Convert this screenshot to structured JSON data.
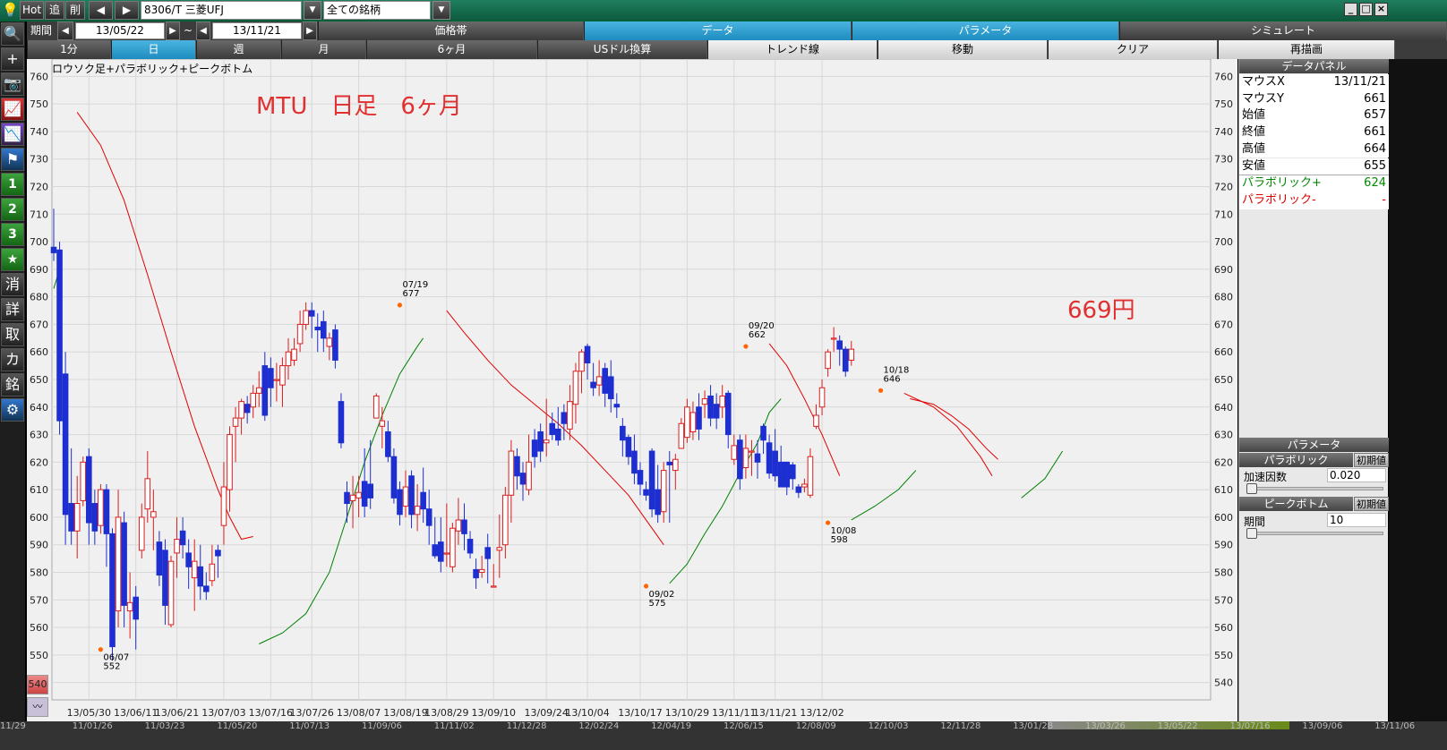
{
  "toolbar": {
    "hot_label": "Hot",
    "add_label": "追",
    "delete_label": "削",
    "symbol_value": "8306/T 三菱UFJ",
    "filter_value": "全ての銘柄",
    "period_label": "期間",
    "date_from": "13/05/22",
    "date_sep": "~",
    "date_to": "13/11/21"
  },
  "tabs_row2": [
    "価格帯",
    "データ",
    "パラメータ",
    "シミュレート"
  ],
  "tabs_row3": [
    "1分",
    "日",
    "週",
    "月",
    "6ヶ月",
    "USドル換算",
    "トレンド線",
    "移動",
    "クリア",
    "再描画"
  ],
  "sidebar": {
    "buttons": [
      "search-icon",
      "crosshair-icon",
      "camera-icon",
      "chart-icon",
      "compare-icon",
      "flag-icon",
      "1",
      "2",
      "3",
      "★",
      "消",
      "詳",
      "取",
      "カ",
      "銘",
      "gear-icon"
    ],
    "labels": [
      "🔍",
      "+",
      "📷",
      "📈",
      "📉",
      "⚑",
      "1",
      "2",
      "3",
      "★",
      "消",
      "詳",
      "取",
      "カ",
      "銘",
      "⚙"
    ]
  },
  "chart": {
    "indicator_label": "ロウソク足+パラボリック+ピークボトム",
    "annotation_title": "MTU　日足　6ヶ月",
    "annotation_price": "669円",
    "mini_label": "540"
  },
  "chart_data": {
    "type": "candlestick",
    "ylim": [
      535,
      765
    ],
    "y_ticks": [
      760,
      750,
      740,
      730,
      720,
      710,
      700,
      690,
      680,
      670,
      660,
      650,
      640,
      630,
      620,
      610,
      600,
      590,
      580,
      570,
      560,
      550,
      540
    ],
    "x_tick_labels": [
      "13/05/30",
      "13/06/11",
      "13/06/21",
      "13/07/03",
      "13/07/16",
      "13/07/26",
      "13/08/07",
      "13/08/19",
      "13/08/29",
      "13/09/10",
      "13/09/24",
      "13/10/04",
      "13/10/17",
      "13/10/29",
      "13/11/11",
      "13/11/21",
      "13/12/02"
    ],
    "x_tick_index": [
      6,
      14,
      21,
      29,
      37,
      44,
      52,
      60,
      67,
      75,
      84,
      91,
      100,
      108,
      116,
      123,
      131
    ],
    "candles": [
      [
        698,
        696,
        712,
        693
      ],
      [
        697,
        635,
        700,
        630
      ],
      [
        652,
        601,
        660,
        590
      ],
      [
        605,
        595,
        625,
        590
      ],
      [
        595,
        605,
        615,
        585
      ],
      [
        606,
        620,
        622,
        604
      ],
      [
        622,
        598,
        625,
        590
      ],
      [
        605,
        595,
        610,
        590
      ],
      [
        597,
        610,
        612,
        594
      ],
      [
        610,
        594,
        612,
        582
      ],
      [
        594,
        553,
        596,
        548
      ],
      [
        566,
        600,
        610,
        560
      ],
      [
        598,
        568,
        602,
        560
      ],
      [
        566,
        569,
        580,
        556
      ],
      [
        571,
        563,
        575,
        552
      ],
      [
        588,
        600,
        605,
        585
      ],
      [
        603,
        614,
        624,
        598
      ],
      [
        600,
        602,
        610,
        588
      ],
      [
        591,
        579,
        595,
        575
      ],
      [
        588,
        568,
        592,
        561
      ],
      [
        561,
        584,
        586,
        560
      ],
      [
        587,
        592,
        600,
        578
      ],
      [
        595,
        590,
        600,
        585
      ],
      [
        587,
        582,
        592,
        574
      ],
      [
        578,
        584,
        592,
        566
      ],
      [
        582,
        575,
        590,
        570
      ],
      [
        575,
        573,
        580,
        570
      ],
      [
        577,
        583,
        590,
        575
      ],
      [
        588,
        586,
        590,
        578
      ],
      [
        597,
        611,
        620,
        590
      ],
      [
        610,
        630,
        633,
        602
      ],
      [
        633,
        636,
        640,
        620
      ],
      [
        636,
        642,
        643,
        630
      ],
      [
        641,
        638,
        644,
        634
      ],
      [
        640,
        645,
        648,
        636
      ],
      [
        645,
        647,
        653,
        640
      ],
      [
        655,
        637,
        660,
        635
      ],
      [
        654,
        647,
        658,
        640
      ],
      [
        650,
        650,
        656,
        642
      ],
      [
        648,
        655,
        658,
        640
      ],
      [
        655,
        660,
        665,
        650
      ],
      [
        657,
        661,
        665,
        655
      ],
      [
        663,
        670,
        675,
        660
      ],
      [
        670,
        675,
        678,
        668
      ],
      [
        675,
        673,
        678,
        665
      ],
      [
        669,
        668,
        674,
        660
      ],
      [
        671,
        665,
        675,
        660
      ],
      [
        662,
        665,
        667,
        657
      ],
      [
        668,
        657,
        670,
        654
      ],
      [
        642,
        627,
        645,
        625
      ],
      [
        609,
        605,
        613,
        598
      ],
      [
        606,
        608,
        615,
        596
      ],
      [
        607,
        609,
        615,
        600
      ],
      [
        613,
        604,
        625,
        600
      ],
      [
        612,
        607,
        628,
        603
      ],
      [
        636,
        644,
        645,
        636
      ],
      [
        633,
        635,
        640,
        625
      ],
      [
        631,
        622,
        635,
        620
      ],
      [
        622,
        607,
        625,
        605
      ],
      [
        610,
        601,
        613,
        597
      ],
      [
        604,
        611,
        617,
        600
      ],
      [
        615,
        601,
        617,
        596
      ],
      [
        601,
        604,
        612,
        595
      ],
      [
        609,
        603,
        618,
        598
      ],
      [
        603,
        597,
        610,
        590
      ],
      [
        590,
        586,
        600,
        585
      ],
      [
        591,
        584,
        600,
        580
      ],
      [
        587,
        587,
        605,
        582
      ],
      [
        582,
        596,
        598,
        580
      ],
      [
        595,
        599,
        607,
        590
      ],
      [
        599,
        594,
        605,
        588
      ],
      [
        592,
        587,
        595,
        585
      ],
      [
        581,
        578,
        585,
        574
      ],
      [
        580,
        581,
        586,
        578
      ],
      [
        589,
        585,
        594,
        576
      ],
      [
        575,
        575,
        583,
        575
      ],
      [
        588,
        589,
        601,
        578
      ],
      [
        590,
        608,
        611,
        585
      ],
      [
        608,
        624,
        628,
        598
      ],
      [
        622,
        615,
        625,
        610
      ],
      [
        616,
        612,
        620,
        606
      ],
      [
        610,
        620,
        630,
        608
      ],
      [
        628,
        622,
        632,
        618
      ],
      [
        631,
        624,
        634,
        620
      ],
      [
        627,
        628,
        643,
        622
      ],
      [
        634,
        630,
        638,
        628
      ],
      [
        632,
        628,
        640,
        626
      ],
      [
        638,
        634,
        641,
        628
      ],
      [
        632,
        642,
        648,
        628
      ],
      [
        641,
        653,
        656,
        634
      ],
      [
        653,
        660,
        661,
        645
      ],
      [
        662,
        656,
        663,
        650
      ],
      [
        649,
        647,
        656,
        644
      ],
      [
        648,
        651,
        657,
        644
      ],
      [
        654,
        645,
        656,
        640
      ],
      [
        651,
        643,
        657,
        638
      ],
      [
        641,
        640,
        645,
        636
      ],
      [
        633,
        628,
        636,
        622
      ],
      [
        629,
        622,
        630,
        619
      ],
      [
        624,
        616,
        630,
        612
      ],
      [
        617,
        612,
        620,
        608
      ],
      [
        610,
        608,
        613,
        606
      ],
      [
        624,
        603,
        625,
        600
      ],
      [
        610,
        601,
        619,
        598
      ],
      [
        602,
        617,
        620,
        598
      ],
      [
        620,
        619,
        624,
        598
      ],
      [
        617,
        621,
        623,
        610
      ],
      [
        625,
        634,
        636,
        625
      ],
      [
        629,
        640,
        643,
        627
      ],
      [
        631,
        638,
        642,
        628
      ],
      [
        640,
        632,
        645,
        628
      ],
      [
        641,
        643,
        646,
        636
      ],
      [
        644,
        636,
        648,
        633
      ],
      [
        641,
        636,
        645,
        632
      ],
      [
        640,
        644,
        648,
        636
      ],
      [
        645,
        630,
        646,
        625
      ],
      [
        621,
        626,
        630,
        619
      ],
      [
        628,
        614,
        630,
        610
      ],
      [
        618,
        625,
        630,
        614
      ],
      [
        624,
        624,
        628,
        615
      ],
      [
        623,
        620,
        628,
        614
      ],
      [
        633,
        628,
        634,
        623
      ],
      [
        627,
        616,
        630,
        614
      ],
      [
        624,
        615,
        632,
        613
      ],
      [
        620,
        611,
        626,
        612
      ],
      [
        620,
        611,
        620,
        608
      ],
      [
        619,
        614,
        620,
        610
      ],
      [
        611,
        609,
        612,
        607
      ],
      [
        611,
        612,
        614,
        609
      ],
      [
        608,
        622,
        625,
        607
      ],
      [
        633,
        637,
        641,
        632
      ],
      [
        640,
        647,
        650,
        637
      ],
      [
        654,
        660,
        661,
        651
      ],
      [
        665,
        665,
        669,
        660
      ],
      [
        664,
        661,
        666,
        655
      ],
      [
        661,
        653,
        662,
        651
      ],
      [
        657,
        661,
        664,
        655
      ]
    ],
    "series": [
      {
        "name": "パラボリック-",
        "color": "#e00000",
        "segments": [
          [
            [
              4,
              747
            ],
            [
              8,
              735
            ],
            [
              12,
              715
            ],
            [
              16,
              688
            ],
            [
              20,
              660
            ],
            [
              24,
              633
            ],
            [
              28,
              610
            ],
            [
              30,
              600
            ],
            [
              32,
              592
            ],
            [
              34,
              593
            ]
          ],
          [
            [
              67,
              675
            ],
            [
              70,
              667
            ],
            [
              74,
              657
            ],
            [
              78,
              648
            ],
            [
              82,
              641
            ],
            [
              86,
              634
            ],
            [
              90,
              626
            ],
            [
              94,
              617
            ],
            [
              98,
              608
            ],
            [
              102,
              596
            ],
            [
              104,
              590
            ]
          ],
          [
            [
              122,
              663
            ],
            [
              125,
              655
            ],
            [
              128,
              643
            ],
            [
              131,
              630
            ],
            [
              133,
              620
            ],
            [
              134,
              615
            ]
          ],
          [
            [
              145,
              645
            ],
            [
              150,
              640
            ],
            [
              154,
              633
            ],
            [
              158,
              622
            ],
            [
              160,
              615
            ]
          ],
          [
            [
              146,
              643
            ],
            [
              150,
              641
            ],
            [
              153,
              637
            ],
            [
              156,
              632
            ],
            [
              159,
              625
            ],
            [
              161,
              621
            ]
          ]
        ]
      },
      {
        "name": "パラボリック+",
        "color": "#008000",
        "segments": [
          [
            [
              0,
              683
            ],
            [
              1,
              690
            ]
          ],
          [
            [
              35,
              554
            ],
            [
              39,
              558
            ],
            [
              43,
              565
            ],
            [
              47,
              580
            ],
            [
              50,
              600
            ],
            [
              53,
              620
            ],
            [
              56,
              637
            ],
            [
              59,
              652
            ],
            [
              62,
              662
            ],
            [
              63,
              665
            ]
          ],
          [
            [
              105,
              576
            ],
            [
              108,
              583
            ],
            [
              111,
              594
            ],
            [
              114,
              604
            ],
            [
              117,
              616
            ],
            [
              120,
              627
            ],
            [
              122,
              638
            ],
            [
              124,
              643
            ]
          ],
          [
            [
              136,
              599
            ],
            [
              140,
              604
            ],
            [
              144,
              610
            ],
            [
              147,
              617
            ]
          ],
          [
            [
              165,
              607
            ],
            [
              169,
              614
            ],
            [
              172,
              624
            ]
          ]
        ]
      }
    ],
    "peaks": [
      {
        "idx": 8,
        "price": 552,
        "date": "06/07",
        "kind": "bottom"
      },
      {
        "idx": 59,
        "price": 677,
        "date": "07/19",
        "kind": "peak"
      },
      {
        "idx": 101,
        "price": 575,
        "date": "09/02",
        "kind": "bottom"
      },
      {
        "idx": 118,
        "price": 662,
        "date": "09/20",
        "kind": "peak"
      },
      {
        "idx": 132,
        "price": 598,
        "date": "10/08",
        "kind": "bottom"
      },
      {
        "idx": 141,
        "price": 646,
        "date": "10/18",
        "kind": "peak"
      }
    ]
  },
  "data_panel": {
    "title": "データパネル",
    "rows": [
      {
        "key": "マウスX",
        "value": "13/11/21"
      },
      {
        "key": "マウスY",
        "value": "661"
      },
      {
        "key": "始値",
        "value": "657"
      },
      {
        "key": "終値",
        "value": "661"
      },
      {
        "key": "高値",
        "value": "664"
      },
      {
        "key": "安値",
        "value": "655"
      }
    ],
    "sar_plus_label": "パラボリック+",
    "sar_plus_value": "624",
    "sar_minus_label": "パラボリック-",
    "sar_minus_value": "-"
  },
  "param_panel": {
    "title": "パラメータ",
    "sar_header": "パラボリック",
    "reset_label": "初期値",
    "accel_label": "加速因数",
    "accel_value": "0.020",
    "accel_fraction": 0.0,
    "peak_header": "ピークボトム",
    "period_label": "期間",
    "period_value": "10",
    "period_fraction": 0.0
  },
  "bottom_dates": [
    "11/29",
    "11/01/26",
    "11/03/23",
    "11/05/20",
    "11/07/13",
    "11/09/06",
    "11/11/02",
    "11/12/28",
    "12/02/24",
    "12/04/19",
    "12/06/15",
    "12/08/09",
    "12/10/03",
    "12/11/28",
    "13/01/28",
    "13/03/26",
    "13/05/22",
    "13/07/16",
    "13/09/06",
    "13/11/06"
  ]
}
